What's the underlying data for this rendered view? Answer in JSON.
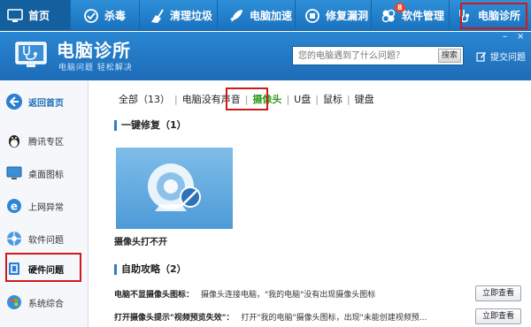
{
  "nav": {
    "home": "首页",
    "items": [
      {
        "label": "杀毒"
      },
      {
        "label": "清理垃圾"
      },
      {
        "label": "电脑加速"
      },
      {
        "label": "修复漏洞"
      },
      {
        "label": "软件管理",
        "badge": "8"
      },
      {
        "label": "电脑诊所"
      }
    ]
  },
  "banner": {
    "title": "电脑诊所",
    "subtitle": "电脑问题 轻松解决",
    "search_placeholder": "您的电脑遇到了什么问题？",
    "search_button": "搜索",
    "submit_question": "提交问题",
    "minimize": "–",
    "close": "×"
  },
  "sidebar": {
    "items": [
      {
        "label": "返回首页"
      },
      {
        "label": "腾讯专区"
      },
      {
        "label": "桌面图标"
      },
      {
        "label": "上网异常"
      },
      {
        "label": "软件问题"
      },
      {
        "label": "硬件问题"
      },
      {
        "label": "系统综合"
      }
    ]
  },
  "main": {
    "tabs": [
      {
        "label": "全部（13）"
      },
      {
        "label": "电脑没有声音"
      },
      {
        "label": "摄像头"
      },
      {
        "label": "U盘"
      },
      {
        "label": "鼠标"
      },
      {
        "label": "键盘"
      }
    ],
    "quick_fix_title": "一键修复（1）",
    "quick_fix_card": "摄像头打不开",
    "guide_title": "自助攻略（2）",
    "guides": [
      {
        "title": "电脑不显摄像头图标：",
        "desc": "摄像头连接电脑，\"我的电脑\"没有出现摄像头图标",
        "button": "立即查看"
      },
      {
        "title": "打开摄像头提示\"视频预览失效\"：",
        "desc": "打开\"我的电脑\"摄像头图标，出现\"未能创建视频预...",
        "button": "立即查看"
      }
    ]
  },
  "colors": {
    "nav_bg": "#1a72bf",
    "active_tab": "#2e9b1f",
    "highlight_box": "#d01a1a"
  }
}
